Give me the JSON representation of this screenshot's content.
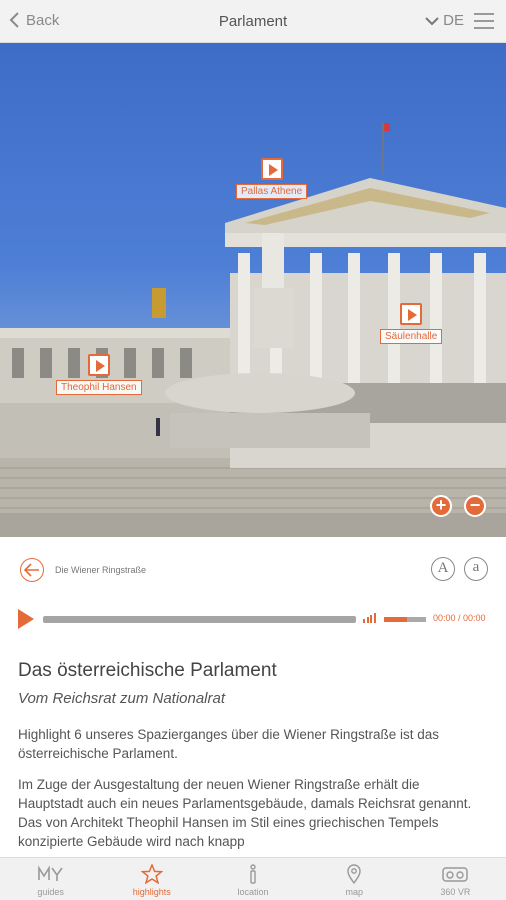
{
  "header": {
    "back_label": "Back",
    "title": "Parlament",
    "language": "DE"
  },
  "hotspots": [
    {
      "label": "Pallas Athene"
    },
    {
      "label": "Säulenhalle"
    },
    {
      "label": "Theophil Hansen"
    }
  ],
  "navigation": {
    "breadcrumb": "Die Wiener Ringstraße",
    "font_larger": "A",
    "font_smaller": "a"
  },
  "player": {
    "time": "00:00 / 00:00",
    "progress": 0,
    "volume": 0.55
  },
  "article": {
    "title": "Das österreichische Parlament",
    "subtitle": "Vom Reichsrat zum Nationalrat",
    "paragraph1": "Highlight 6 unseres Spazierganges über die Wiener Ringstraße ist das österreichische Parlament.",
    "paragraph2": "Im Zuge der Ausgestaltung der neuen Wiener Ringstraße erhält die Hauptstadt auch ein neues Parlamentsgebäude, damals Reichsrat genannt. Das von Architekt Theophil Hansen im Stil eines griechischen Tempels konzipierte Gebäude wird nach knapp"
  },
  "tabs": [
    {
      "label": "guides",
      "icon": "my-guides-icon"
    },
    {
      "label": "highlights",
      "icon": "star-icon",
      "active": true
    },
    {
      "label": "location",
      "icon": "info-icon"
    },
    {
      "label": "map",
      "icon": "map-pin-icon"
    },
    {
      "label": "360 VR",
      "icon": "vr-headset-icon"
    }
  ],
  "colors": {
    "accent": "#e56a3a",
    "sky": "#4677cf"
  }
}
